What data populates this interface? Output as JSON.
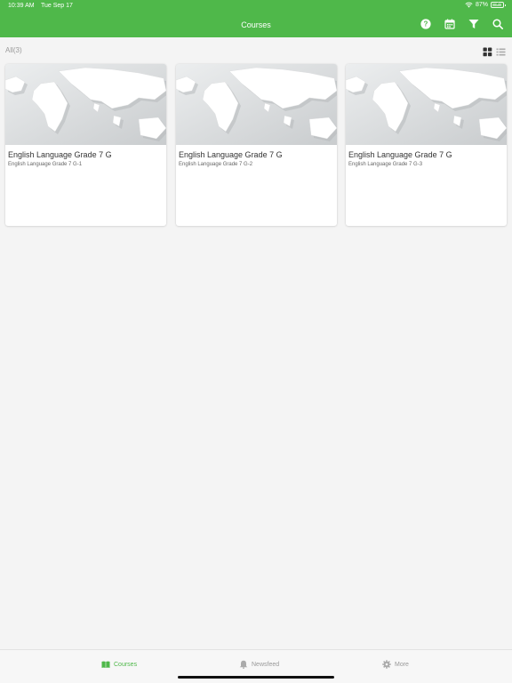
{
  "status": {
    "time": "10:39 AM",
    "date": "Tue Sep 17",
    "battery": "87%"
  },
  "header": {
    "title": "Courses",
    "icons": [
      "help-icon",
      "calendar-icon",
      "filter-icon",
      "search-icon"
    ]
  },
  "filter": {
    "label": "All(3)",
    "view_modes": [
      "grid-view-icon",
      "list-view-icon"
    ],
    "active_view": "grid"
  },
  "courses": [
    {
      "title": "English Language Grade 7 G",
      "subtitle": "English Language Grade 7 G-1"
    },
    {
      "title": "English Language Grade 7 G",
      "subtitle": "English Language Grade 7 G-2"
    },
    {
      "title": "English Language Grade 7 G",
      "subtitle": "English Language Grade 7 G-3"
    }
  ],
  "tabbar": {
    "items": [
      {
        "label": "Courses",
        "icon": "book-icon",
        "active": true
      },
      {
        "label": "Newsfeed",
        "icon": "bell-icon",
        "active": false
      },
      {
        "label": "More",
        "icon": "gear-icon",
        "active": false
      }
    ]
  },
  "colors": {
    "brand_green": "#4fb84a",
    "background": "#f4f4f4"
  }
}
